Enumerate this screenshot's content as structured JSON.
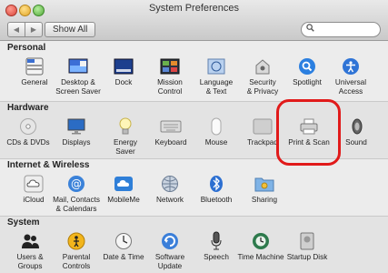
{
  "window": {
    "title": "System Preferences"
  },
  "toolbar": {
    "show_all": "Show All",
    "back": "◀",
    "forward": "▶",
    "search_placeholder": "",
    "search_glyph": "🔍"
  },
  "sections": [
    {
      "title": "Personal",
      "items": [
        {
          "label": "General",
          "icon": "general-icon"
        },
        {
          "label": "Desktop &\nScreen Saver",
          "icon": "desktop-icon"
        },
        {
          "label": "Dock",
          "icon": "dock-icon"
        },
        {
          "label": "Mission\nControl",
          "icon": "mission-control-icon"
        },
        {
          "label": "Language\n& Text",
          "icon": "language-icon"
        },
        {
          "label": "Security\n& Privacy",
          "icon": "security-icon"
        },
        {
          "label": "Spotlight",
          "icon": "spotlight-icon"
        },
        {
          "label": "Universal\nAccess",
          "icon": "universal-access-icon"
        }
      ]
    },
    {
      "title": "Hardware",
      "items": [
        {
          "label": "CDs & DVDs",
          "icon": "cd-dvd-icon"
        },
        {
          "label": "Displays",
          "icon": "display-icon"
        },
        {
          "label": "Energy\nSaver",
          "icon": "energy-saver-icon"
        },
        {
          "label": "Keyboard",
          "icon": "keyboard-icon"
        },
        {
          "label": "Mouse",
          "icon": "mouse-icon"
        },
        {
          "label": "Trackpad",
          "icon": "trackpad-icon"
        },
        {
          "label": "Print & Scan",
          "icon": "printer-icon"
        },
        {
          "label": "Sound",
          "icon": "sound-icon"
        }
      ]
    },
    {
      "title": "Internet & Wireless",
      "items": [
        {
          "label": "iCloud",
          "icon": "icloud-icon"
        },
        {
          "label": "Mail, Contacts\n& Calendars",
          "icon": "mail-icon"
        },
        {
          "label": "MobileMe",
          "icon": "mobileme-icon"
        },
        {
          "label": "Network",
          "icon": "network-icon"
        },
        {
          "label": "Bluetooth",
          "icon": "bluetooth-icon"
        },
        {
          "label": "Sharing",
          "icon": "sharing-icon"
        }
      ]
    },
    {
      "title": "System",
      "items": [
        {
          "label": "Users &\nGroups",
          "icon": "users-icon"
        },
        {
          "label": "Parental\nControls",
          "icon": "parental-controls-icon"
        },
        {
          "label": "Date & Time",
          "icon": "clock-icon"
        },
        {
          "label": "Software\nUpdate",
          "icon": "software-update-icon"
        },
        {
          "label": "Speech",
          "icon": "microphone-icon"
        },
        {
          "label": "Time Machine",
          "icon": "time-machine-icon"
        },
        {
          "label": "Startup Disk",
          "icon": "startup-disk-icon"
        }
      ]
    }
  ]
}
